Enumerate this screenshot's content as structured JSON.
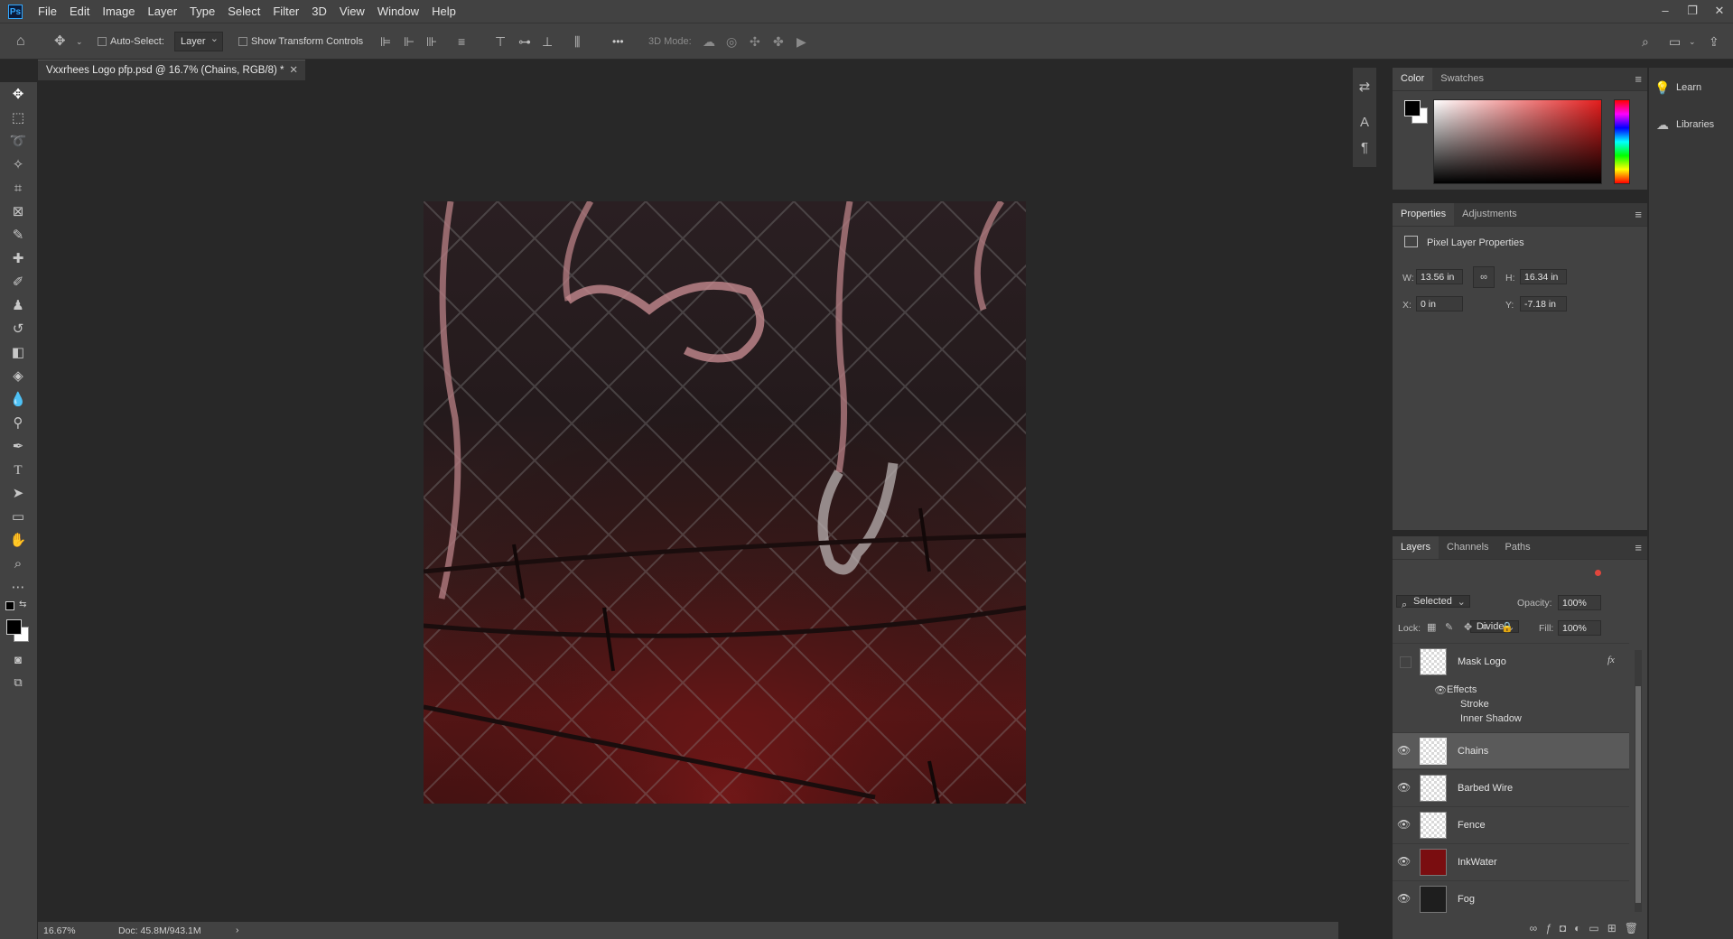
{
  "app": {
    "logo_text": "Ps"
  },
  "menu": [
    "File",
    "Edit",
    "Image",
    "Layer",
    "Type",
    "Select",
    "Filter",
    "3D",
    "View",
    "Window",
    "Help"
  ],
  "window_controls": {
    "minimize": "–",
    "restore": "❐",
    "close": "✕"
  },
  "options_bar": {
    "auto_select_label": "Auto-Select:",
    "auto_select_target": "Layer",
    "show_transform_label": "Show Transform Controls",
    "mode_3d_label": "3D Mode:",
    "more_label": "•••"
  },
  "document": {
    "tab_title": "Vxxrhees Logo pfp.psd @ 16.7% (Chains, RGB/8) *",
    "close": "✕"
  },
  "status": {
    "zoom": "16.67%",
    "doc": "Doc: 45.8M/943.1M",
    "arrow": "›"
  },
  "color_panel": {
    "tabs": [
      "Color",
      "Swatches"
    ],
    "foreground": "#000000",
    "background": "#ffffff",
    "hue_color": "#e41d1d"
  },
  "properties_panel": {
    "tabs": [
      "Properties",
      "Adjustments"
    ],
    "header": "Pixel Layer Properties",
    "w_label": "W:",
    "w_value": "13.56 in",
    "h_label": "H:",
    "h_value": "16.34 in",
    "x_label": "X:",
    "x_value": "0 in",
    "y_label": "Y:",
    "y_value": "-7.18 in"
  },
  "layers_panel": {
    "tabs": [
      "Layers",
      "Channels",
      "Paths"
    ],
    "filter_value": "Selected",
    "blend_mode": "Divide",
    "opacity_label": "Opacity:",
    "opacity_value": "100%",
    "lock_label": "Lock:",
    "fill_label": "Fill:",
    "fill_value": "100%",
    "effects_label": "Effects",
    "effects": [
      "Stroke",
      "Inner Shadow"
    ],
    "fx_label": "fx",
    "layers": [
      {
        "name": "Mask Logo",
        "visible": false,
        "selected": false
      },
      {
        "name": "Chains",
        "visible": true,
        "selected": true
      },
      {
        "name": "Barbed Wire",
        "visible": true,
        "selected": false
      },
      {
        "name": "Fence",
        "visible": true,
        "selected": false
      },
      {
        "name": "InkWater",
        "visible": true,
        "selected": false
      },
      {
        "name": "Fog",
        "visible": true,
        "selected": false
      }
    ]
  },
  "side_panel": {
    "learn_label": "Learn",
    "libraries_label": "Libraries"
  },
  "colors": {
    "accent": "#31a8ff",
    "selected_row": "#5a5a5a"
  }
}
